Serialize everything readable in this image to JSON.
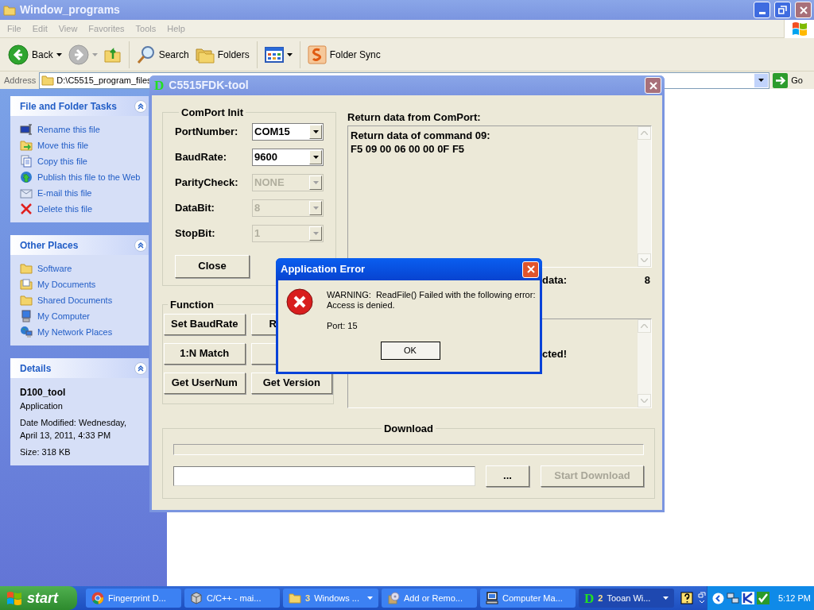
{
  "explorer": {
    "title": "Window_programs",
    "menu": [
      "File",
      "Edit",
      "View",
      "Favorites",
      "Tools",
      "Help"
    ],
    "toolbar": [
      {
        "kind": "back",
        "label": "Back"
      },
      {
        "kind": "forward"
      },
      {
        "kind": "up"
      },
      {
        "kind": "search",
        "label": "Search"
      },
      {
        "kind": "folders",
        "label": "Folders"
      },
      {
        "kind": "views"
      },
      {
        "kind": "sync",
        "label": "Folder Sync"
      }
    ],
    "address": {
      "label": "Address",
      "value": "D:\\C5515_program_files",
      "go": "Go"
    },
    "panels": [
      {
        "kind": "links",
        "title": "File and Folder Tasks",
        "items": [
          {
            "label": "Rename this file"
          },
          {
            "label": "Move this file"
          },
          {
            "label": "Copy this file"
          },
          {
            "label": "Publish this file to the Web"
          },
          {
            "label": "E-mail this file"
          },
          {
            "label": "Delete this file"
          }
        ]
      },
      {
        "kind": "links",
        "title": "Other Places",
        "items": [
          {
            "label": "Software"
          },
          {
            "label": "My Documents"
          },
          {
            "label": "Shared Documents"
          },
          {
            "label": "My Computer"
          },
          {
            "label": "My Network Places"
          }
        ]
      },
      {
        "kind": "details",
        "title": "Details",
        "name": "D100_tool",
        "type": "Application",
        "lines": [
          "Date Modified: Wednesday, April 13, 2011, 4:33 PM",
          "Size: 318 KB"
        ]
      }
    ]
  },
  "tool": {
    "logo": "D",
    "title": "C5515FDK-tool",
    "comport": {
      "title": "ComPort Init",
      "fields": [
        {
          "label": "PortNumber:",
          "value": "COM15",
          "disabled": false
        },
        {
          "label": "BaudRate:",
          "value": "9600",
          "disabled": false
        },
        {
          "label": "ParityCheck:",
          "value": "NONE",
          "disabled": true
        },
        {
          "label": "DataBit:",
          "value": "8",
          "disabled": true
        },
        {
          "label": "StopBit:",
          "value": "1",
          "disabled": true
        }
      ],
      "button": "Close"
    },
    "function": {
      "title": "Function",
      "buttons": [
        {
          "kind": "text",
          "label": "Set BaudRate",
          "clipped": false
        },
        {
          "kind": "text",
          "label": "R",
          "clipped": true
        },
        {
          "kind": "text",
          "label": "1:N Match",
          "clipped": false
        },
        {
          "kind": "blank"
        },
        {
          "kind": "text",
          "label": "Get UserNum",
          "clipped": false
        },
        {
          "kind": "text",
          "label": "Get Version",
          "clipped": false
        }
      ]
    },
    "return": {
      "label": "Return data from ComPort:",
      "lines": [
        "Return data of command 09:",
        "F5 09 00 06 00 00 0F F5"
      ]
    },
    "count": {
      "label": "data:",
      "value": "8"
    },
    "status": {
      "text": "cted!"
    },
    "download": {
      "title": "Download",
      "level": 0,
      "browse": "...",
      "start": {
        "label": "Start Download",
        "disabled": true
      }
    }
  },
  "dialog": {
    "title": "Application Error",
    "message": [
      "WARNING:  ReadFile() Failed with the following error:",
      "Access is denied."
    ],
    "detail": "Port: 15",
    "ok": "OK"
  },
  "taskbar": {
    "start": "start",
    "items": [
      {
        "label": "Fingerprint D...",
        "selected": false
      },
      {
        "label": "C/C++ - mai...",
        "selected": false
      },
      {
        "count": "3",
        "label": "Windows ...",
        "selected": false
      },
      {
        "label": "Add or Remo...",
        "selected": false
      },
      {
        "label": "Computer Ma...",
        "selected": false
      },
      {
        "letter": "D",
        "count": "2",
        "label": "Tooan Wi...",
        "selected": true
      }
    ],
    "clock": "5:12 PM"
  }
}
